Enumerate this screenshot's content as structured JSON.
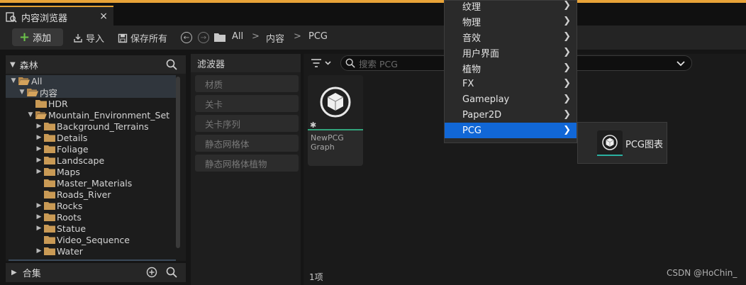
{
  "tab": {
    "title": "内容浏览器",
    "close": "×"
  },
  "toolbar": {
    "add_label": "添加",
    "import_label": "导入",
    "save_all_label": "保存所有",
    "breadcrumb": [
      "All",
      "内容",
      "PCG"
    ],
    "sep": ">"
  },
  "sources": {
    "header": "森林",
    "tree": [
      {
        "label": "All",
        "depth": 0,
        "arrow": "open",
        "selected": true
      },
      {
        "label": "内容",
        "depth": 1,
        "arrow": "open",
        "selected": true
      },
      {
        "label": "HDR",
        "depth": 2,
        "arrow": "none",
        "selected": false
      },
      {
        "label": "Mountain_Environment_Set",
        "depth": 2,
        "arrow": "open",
        "selected": false
      },
      {
        "label": "Background_Terrains",
        "depth": 3,
        "arrow": "closed",
        "selected": false
      },
      {
        "label": "Details",
        "depth": 3,
        "arrow": "closed",
        "selected": false
      },
      {
        "label": "Foliage",
        "depth": 3,
        "arrow": "closed",
        "selected": false
      },
      {
        "label": "Landscape",
        "depth": 3,
        "arrow": "closed",
        "selected": false
      },
      {
        "label": "Maps",
        "depth": 3,
        "arrow": "closed",
        "selected": false
      },
      {
        "label": "Master_Materials",
        "depth": 3,
        "arrow": "none",
        "selected": false
      },
      {
        "label": "Roads_River",
        "depth": 3,
        "arrow": "none",
        "selected": false
      },
      {
        "label": "Rocks",
        "depth": 3,
        "arrow": "closed",
        "selected": false
      },
      {
        "label": "Roots",
        "depth": 3,
        "arrow": "closed",
        "selected": false
      },
      {
        "label": "Statue",
        "depth": 3,
        "arrow": "closed",
        "selected": false
      },
      {
        "label": "Video_Sequence",
        "depth": 3,
        "arrow": "none",
        "selected": false
      },
      {
        "label": "Water",
        "depth": 3,
        "arrow": "closed",
        "selected": false
      }
    ],
    "collections_label": "合集"
  },
  "filters": {
    "header": "滤波器",
    "items": [
      "材质",
      "关卡",
      "关卡序列",
      "静态网格体",
      "静态网格体植物"
    ]
  },
  "content": {
    "search_placeholder": "搜索 PCG",
    "asset": {
      "name_line1": "NewPCG",
      "name_line2": "Graph"
    },
    "item_count": "1项",
    "watermark": "CSDN @HoChin_"
  },
  "context_menu": {
    "items": [
      "纹理",
      "物理",
      "音效",
      "用户界面",
      "植物",
      "FX",
      "Gameplay",
      "Paper2D",
      "PCG"
    ],
    "active": "PCG",
    "submenu_label": "PCG图表"
  },
  "colors": {
    "accent_orange": "#e8a338",
    "highlight_blue": "#1167d6",
    "asset_bar": "#32a37b",
    "add_plus": "#6bc24a"
  }
}
